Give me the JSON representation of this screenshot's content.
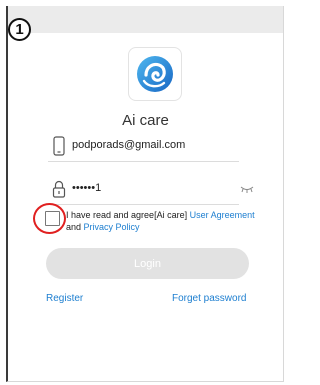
{
  "step_badge": "1",
  "app": {
    "title": "Ai care",
    "logo_icon": "ai-care-swirl-logo",
    "accent_color": "#1e7fd0"
  },
  "form": {
    "email_value": "podporads@gmail.com",
    "password_value": "••••••1",
    "agreement": {
      "checked": false,
      "text_before": "I have read and agree[Ai care] ",
      "user_agreement_link": "User Agreement",
      "text_and": " and ",
      "privacy_policy_link": "Privacy Policy"
    },
    "login_label": "Login"
  },
  "links": {
    "register": "Register",
    "forgot_password": "Forget password"
  }
}
